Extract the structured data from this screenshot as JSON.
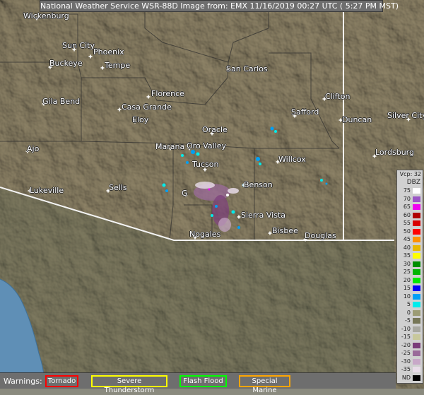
{
  "title": "National Weather Service WSR-88D Image from: EMX 11/16/2019 00:27 UTC ( 5:27 PM MST)",
  "cities": [
    {
      "name": "Wickenburg",
      "id": "wickenburg"
    },
    {
      "name": "Sun City",
      "id": "sun-city"
    },
    {
      "name": "Phoenix",
      "id": "phoenix"
    },
    {
      "name": "Buckeye",
      "id": "buckeye"
    },
    {
      "name": "Tempe",
      "id": "tempe"
    },
    {
      "name": "San Carlos",
      "id": "san-carlos"
    },
    {
      "name": "Florence",
      "id": "florence"
    },
    {
      "name": "Gila Bend",
      "id": "gila-bend"
    },
    {
      "name": "Casa Grande",
      "id": "casa-grande"
    },
    {
      "name": "Clifton",
      "id": "clifton"
    },
    {
      "name": "Safford",
      "id": "safford"
    },
    {
      "name": "Duncan",
      "id": "duncan"
    },
    {
      "name": "Silver City",
      "id": "silver-city"
    },
    {
      "name": "Eloy",
      "id": "eloy"
    },
    {
      "name": "Oracle",
      "id": "oracle"
    },
    {
      "name": "Ajo",
      "id": "ajo"
    },
    {
      "name": "Marana",
      "id": "marana"
    },
    {
      "name": "Oro Valley",
      "id": "oro-valley"
    },
    {
      "name": "Lordsburg",
      "id": "lordsburg"
    },
    {
      "name": "Willcox",
      "id": "willcox"
    },
    {
      "name": "Tucson",
      "id": "tucson"
    },
    {
      "name": "Lukeville",
      "id": "lukeville"
    },
    {
      "name": "Sells",
      "id": "sells"
    },
    {
      "name": "Benson",
      "id": "benson"
    },
    {
      "name": "G",
      "id": "green-valley-partial"
    },
    {
      "name": "Sierra Vista",
      "id": "sierra-vista"
    },
    {
      "name": "Bisbee",
      "id": "bisbee"
    },
    {
      "name": "Douglas",
      "id": "douglas"
    },
    {
      "name": "Nogales",
      "id": "nogales"
    }
  ],
  "legend": {
    "vcp": "Vcp: 32",
    "unit": "DBZ",
    "rows": [
      {
        "label": "75",
        "color": "#ffffff"
      },
      {
        "label": "70",
        "color": "#9a55c6"
      },
      {
        "label": "65",
        "color": "#f000f0"
      },
      {
        "label": "60",
        "color": "#b00000"
      },
      {
        "label": "55",
        "color": "#d80000"
      },
      {
        "label": "50",
        "color": "#ff0000"
      },
      {
        "label": "45",
        "color": "#ff9000"
      },
      {
        "label": "40",
        "color": "#e8b800"
      },
      {
        "label": "35",
        "color": "#ffff00"
      },
      {
        "label": "30",
        "color": "#008e00"
      },
      {
        "label": "25",
        "color": "#00b400"
      },
      {
        "label": "20",
        "color": "#00e800"
      },
      {
        "label": "15",
        "color": "#0000f6"
      },
      {
        "label": "10",
        "color": "#00a0f6"
      },
      {
        "label": "5",
        "color": "#00ecec"
      },
      {
        "label": "0",
        "color": "#9c9c74"
      },
      {
        "label": "-5",
        "color": "#767656"
      },
      {
        "label": "-10",
        "color": "#a8a8a0"
      },
      {
        "label": "-15",
        "color": "#c8c89c"
      },
      {
        "label": "-20",
        "color": "#7a3c7a"
      },
      {
        "label": "-25",
        "color": "#9a6a9a"
      },
      {
        "label": "-30",
        "color": "#c8a8c8"
      },
      {
        "label": "-35",
        "color": "#e8dce8"
      },
      {
        "label": "ND",
        "color": "#000000"
      }
    ]
  },
  "warnings": {
    "title": "Warnings:",
    "items": [
      {
        "label": "Tornado",
        "color": "#ff0000"
      },
      {
        "label": "Severe Thunderstorm",
        "color": "#ffff00"
      },
      {
        "label": "Flash Flood",
        "color": "#00ff00"
      },
      {
        "label": "Special Marine",
        "color": "#ffa500"
      }
    ]
  }
}
